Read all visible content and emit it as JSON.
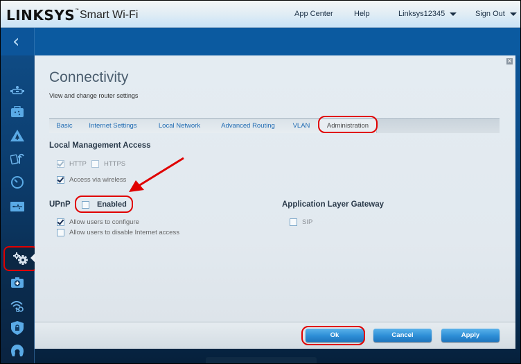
{
  "header": {
    "logo": "LINKSYS",
    "logo_tm": "™",
    "brand": "Smart Wi-Fi",
    "links": {
      "app_center": "App Center",
      "help": "Help",
      "account": "Linksys12345",
      "sign_out": "Sign Out"
    }
  },
  "sidebar": {
    "items": [
      {
        "name": "device-list",
        "icon": "devices-icon"
      },
      {
        "name": "guest-access",
        "icon": "briefcase-icon"
      },
      {
        "name": "parental-controls",
        "icon": "warning-tree-icon"
      },
      {
        "name": "media-prioritization",
        "icon": "media-refresh-icon"
      },
      {
        "name": "speed-test",
        "icon": "speedometer-icon"
      },
      {
        "name": "external-storage",
        "icon": "usb-icon"
      },
      {
        "name": "connectivity",
        "icon": "gears-icon",
        "active": true
      },
      {
        "name": "troubleshooting",
        "icon": "medical-kit-icon"
      },
      {
        "name": "wireless",
        "icon": "wifi-gear-icon"
      },
      {
        "name": "security",
        "icon": "shield-lock-icon"
      },
      {
        "name": "openvpn",
        "icon": "open-source-icon"
      }
    ]
  },
  "panel": {
    "title": "Connectivity",
    "subtitle": "View and change router settings",
    "close_icon": "close-icon",
    "tabs": [
      {
        "label": "Basic"
      },
      {
        "label": "Internet Settings"
      },
      {
        "label": "Local Network"
      },
      {
        "label": "Advanced Routing"
      },
      {
        "label": "VLAN"
      },
      {
        "label": "Administration",
        "selected": true
      }
    ],
    "local_management": {
      "title": "Local Management Access",
      "http": {
        "label": "HTTP",
        "checked": true,
        "disabled": true
      },
      "https": {
        "label": "HTTPS",
        "checked": false,
        "disabled": true
      },
      "wireless": {
        "label": "Access via wireless",
        "checked": true
      }
    },
    "upnp": {
      "title": "UPnP",
      "enabled": {
        "label": "Enabled",
        "checked": false
      },
      "allow_configure": {
        "label": "Allow users to configure",
        "checked": true
      },
      "allow_disable": {
        "label": "Allow users to disable Internet access",
        "checked": false
      }
    },
    "alg": {
      "title": "Application Layer Gateway",
      "sip": {
        "label": "SIP",
        "checked": false
      }
    }
  },
  "footer": {
    "ok": "Ok",
    "cancel": "Cancel",
    "apply": "Apply"
  },
  "annotations": {
    "highlight_color": "#e00000"
  }
}
